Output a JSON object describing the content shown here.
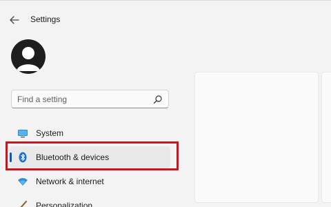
{
  "window": {
    "title": "Settings"
  },
  "search": {
    "placeholder": "Find a setting"
  },
  "sidebar": {
    "items": [
      {
        "label": "System",
        "icon": "monitor-icon",
        "selected": false
      },
      {
        "label": "Bluetooth & devices",
        "icon": "bluetooth-icon",
        "selected": true
      },
      {
        "label": "Network & internet",
        "icon": "wifi-icon",
        "selected": false
      },
      {
        "label": "Personalization",
        "icon": "brush-icon",
        "selected": false
      }
    ]
  },
  "colors": {
    "accent": "#005fb8",
    "highlight_box": "#c9161c",
    "background": "#f3f3f3"
  }
}
